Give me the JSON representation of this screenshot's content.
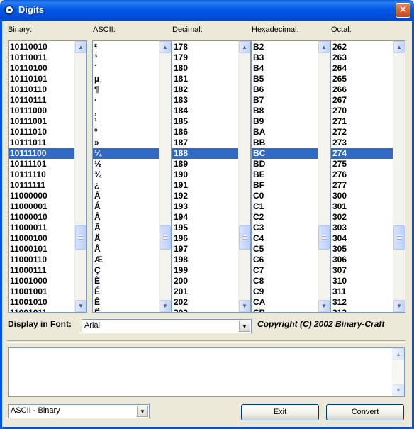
{
  "window": {
    "title": "Digits",
    "close_glyph": "✕"
  },
  "columns": [
    {
      "label": "Binary:",
      "items": [
        "10110010",
        "10110011",
        "10110100",
        "10110101",
        "10110110",
        "10110111",
        "10111000",
        "10111001",
        "10111010",
        "10111011",
        "10111100",
        "10111101",
        "10111110",
        "10111111",
        "11000000",
        "11000001",
        "11000010",
        "11000011",
        "11000100",
        "11000101",
        "11000110",
        "11000111",
        "11001000",
        "11001001",
        "11001010",
        "11001011"
      ],
      "selected_index": 10
    },
    {
      "label": "ASCII:",
      "items": [
        "²",
        "³",
        "´",
        "µ",
        "¶",
        "·",
        "¸",
        "¹",
        "º",
        "»",
        "¼",
        "½",
        "¾",
        "¿",
        "À",
        "Á",
        "Â",
        "Ã",
        "Ä",
        "Å",
        "Æ",
        "Ç",
        "È",
        "É",
        "Ê",
        "Ë"
      ],
      "selected_index": 10
    },
    {
      "label": "Decimal:",
      "items": [
        "178",
        "179",
        "180",
        "181",
        "182",
        "183",
        "184",
        "185",
        "186",
        "187",
        "188",
        "189",
        "190",
        "191",
        "192",
        "193",
        "194",
        "195",
        "196",
        "197",
        "198",
        "199",
        "200",
        "201",
        "202",
        "203"
      ],
      "selected_index": 10
    },
    {
      "label": "Hexadecimal:",
      "items": [
        "B2",
        "B3",
        "B4",
        "B5",
        "B6",
        "B7",
        "B8",
        "B9",
        "BA",
        "BB",
        "BC",
        "BD",
        "BE",
        "BF",
        "C0",
        "C1",
        "C2",
        "C3",
        "C4",
        "C5",
        "C6",
        "C7",
        "C8",
        "C9",
        "CA",
        "CB"
      ],
      "selected_index": 10
    },
    {
      "label": "Octal:",
      "items": [
        "262",
        "263",
        "264",
        "265",
        "266",
        "267",
        "270",
        "271",
        "272",
        "273",
        "274",
        "275",
        "276",
        "277",
        "300",
        "301",
        "302",
        "303",
        "304",
        "305",
        "306",
        "307",
        "310",
        "311",
        "312",
        "313"
      ],
      "selected_index": 10
    }
  ],
  "font_row": {
    "label": "Display in Font:",
    "value": "Arial",
    "copyright": "Copyright (C) 2002 Binary-Craft"
  },
  "memo": {
    "value": ""
  },
  "conversion": {
    "value": "ASCII - Binary"
  },
  "buttons": {
    "exit": "Exit",
    "convert": "Convert"
  },
  "colors": {
    "title_bar": "#0054e3",
    "selection": "#316ac5",
    "face": "#ece9d8"
  },
  "icons": {
    "scroll_up": "▲",
    "scroll_down": "▼",
    "dropdown": "▼"
  }
}
